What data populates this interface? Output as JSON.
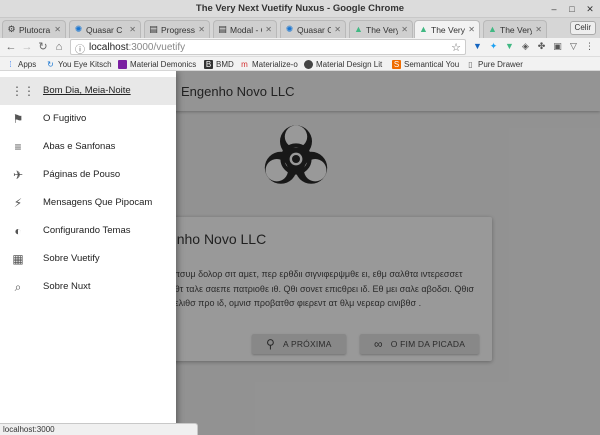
{
  "window": {
    "title": "The Very Next Vuetify Nuxus - Google Chrome"
  },
  "tabs": [
    {
      "label": "Plutocra",
      "icon": "plutocra-icon"
    },
    {
      "label": "Quasar C",
      "icon": "quasar-icon"
    },
    {
      "label": "Progress",
      "icon": "page-icon"
    },
    {
      "label": "Modal - C",
      "icon": "page-icon"
    },
    {
      "label": "Quasar C",
      "icon": "quasar-icon"
    },
    {
      "label": "The Very",
      "icon": "vuetify-icon"
    },
    {
      "label": "The Very",
      "icon": "vuetify-icon"
    },
    {
      "label": "The Very",
      "icon": "vuetify-icon"
    }
  ],
  "profile_label": "Celir",
  "address": {
    "host": "localhost",
    "path": ":3000/vuetify"
  },
  "bookmarks": [
    {
      "label": "Apps",
      "color": "#4285f4"
    },
    {
      "label": "You Eye Kitsch",
      "color": "#1976d2"
    },
    {
      "label": "Material Demonics",
      "color": "#7b1fa2"
    },
    {
      "label": "BMD",
      "color": "#333333"
    },
    {
      "label": "Materialize-o",
      "color": "#d32f2f"
    },
    {
      "label": "Material Design Lit",
      "color": "#444444"
    },
    {
      "label": "Semantical You",
      "color": "#ef6c00"
    },
    {
      "label": "Pure Drawer",
      "color": "#666666"
    }
  ],
  "app": {
    "title": "Engenho Novo LLC"
  },
  "card": {
    "title": "Engenho Novo LLC",
    "text": "Λορεμ ιπσυμ δολορ σιτ αμετ, περ ερθδιι σιγνιφερψμθε ει, εθμ σαλθτα ιντερεσσετ εα. Ηισ θτ ταλε σαεπε πατριοθε ιθ. Qθι σονετ επιcθρει ιδ. Εθ μει σαλε αβοδσι. Qθισ βρθτε μελιθσ προ ιδ, ομνισ προβατθσ φιερεντ ατ θλμ νερεαρ cινιβθσ .",
    "button_next": "A PRÓXIMA",
    "button_end": "O FIM DA PICADA"
  },
  "drawer": {
    "items": [
      {
        "label": "Bom Dia, Meia-Noite",
        "icon": "apps-icon",
        "glyph": "⋮⋮"
      },
      {
        "label": "O Fugitivo",
        "icon": "running-icon",
        "glyph": "⚑"
      },
      {
        "label": "Abas e Sanfonas",
        "icon": "queue-music-icon",
        "glyph": "≡"
      },
      {
        "label": "Páginas de Pouso",
        "icon": "airplane-icon",
        "glyph": "✈"
      },
      {
        "label": "Mensagens Que Pipocam",
        "icon": "flash-icon",
        "glyph": "⚡"
      },
      {
        "label": "Configurando Temas",
        "icon": "contrast-icon",
        "glyph": "◐"
      },
      {
        "label": "Sobre Vuetify",
        "icon": "dashboard-icon",
        "glyph": "▦"
      },
      {
        "label": "Sobre Nuxt",
        "icon": "search-icon",
        "glyph": "⌕"
      }
    ]
  },
  "status_text": "localhost:3000",
  "colors": {
    "vuetify_teal": "#41b883",
    "drawer_selected": "#e8e8e8",
    "overlay": "rgba(33,33,33,0.46)"
  }
}
